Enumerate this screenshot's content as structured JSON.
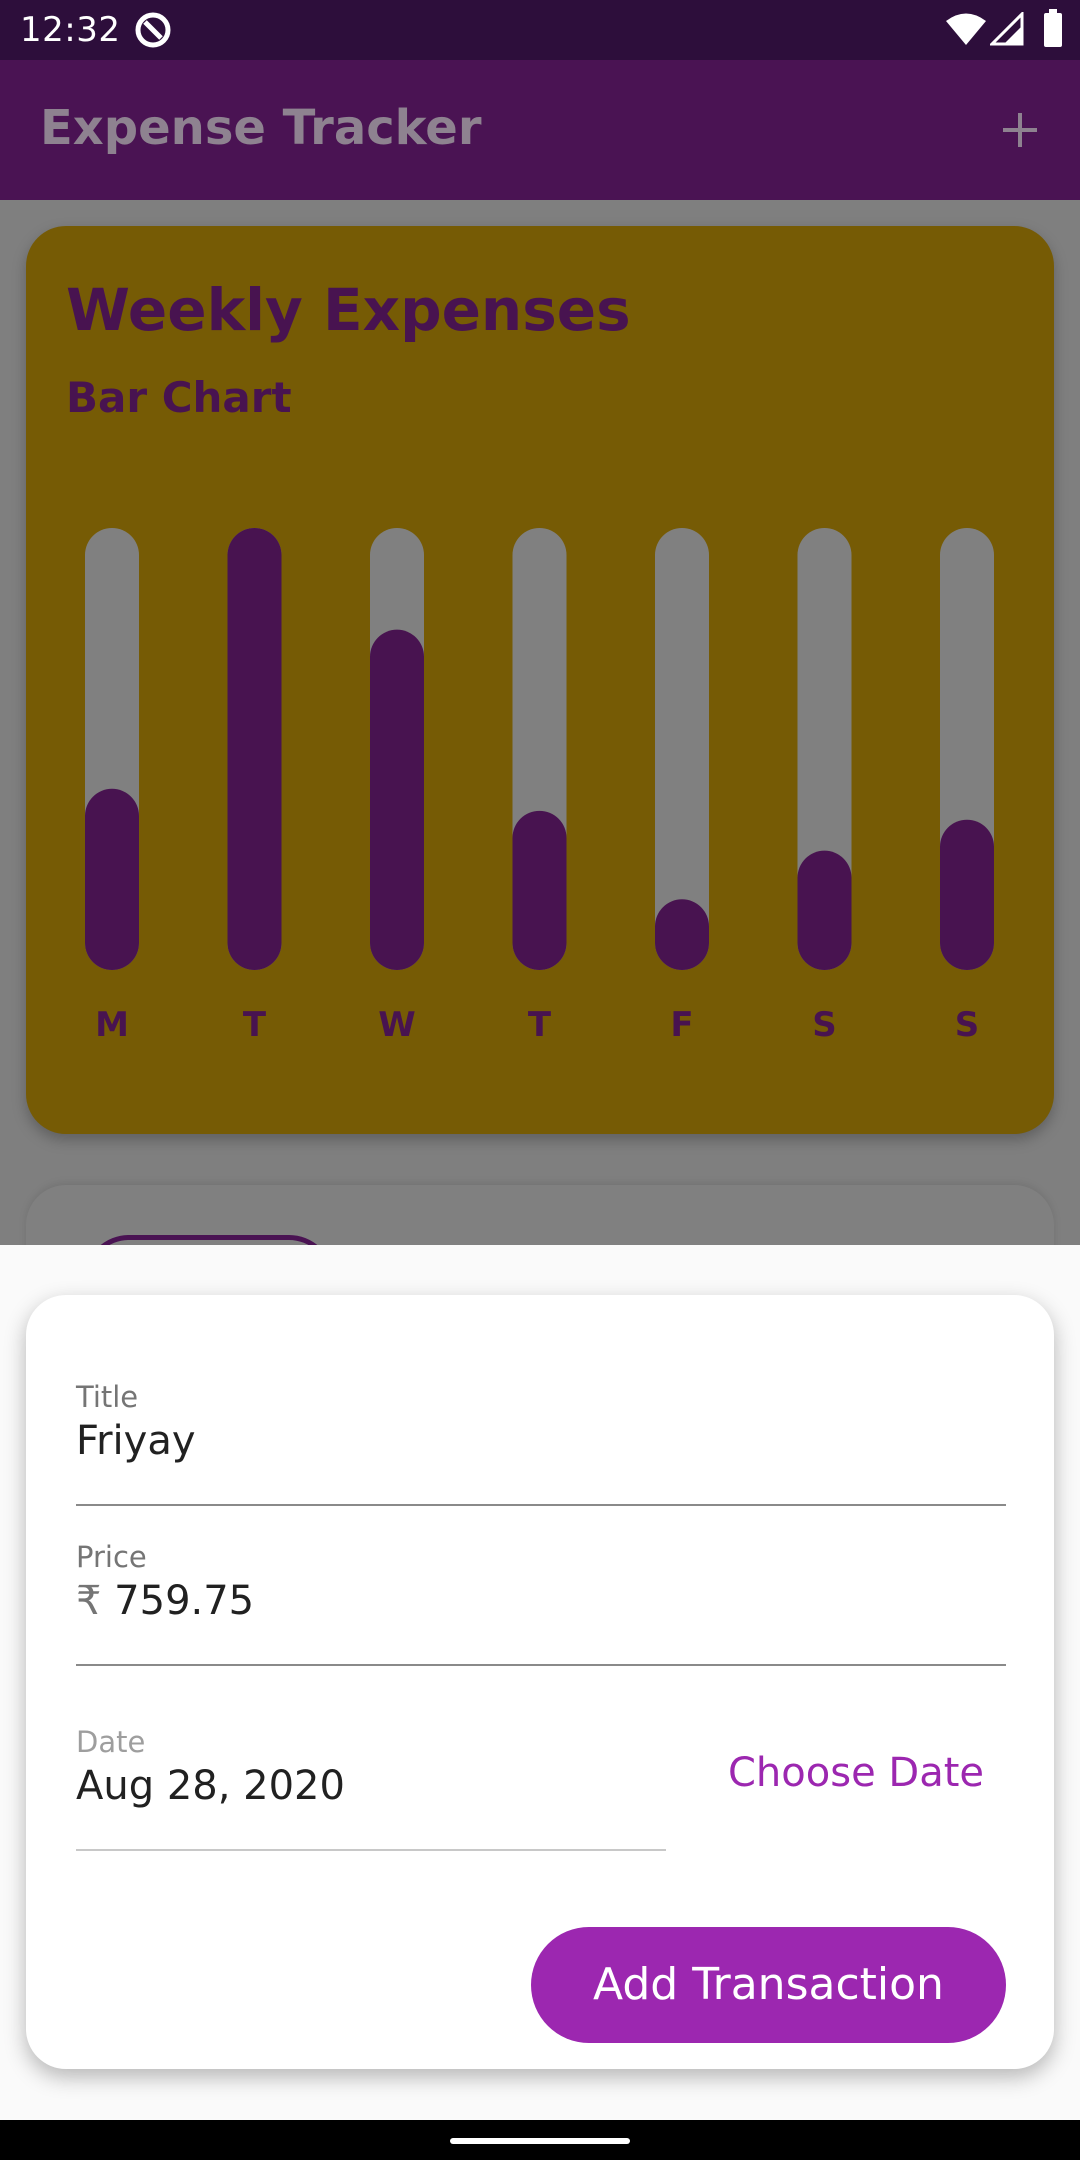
{
  "status_bar": {
    "time": "12:32",
    "app_icon": "no-disturb-icon",
    "wifi_icon": "wifi-icon",
    "signal_icon": "cell-signal-icon",
    "battery_icon": "battery-icon"
  },
  "app_bar": {
    "title": "Expense Tracker",
    "add_icon": "plus-icon"
  },
  "chart": {
    "title": "Weekly Expenses",
    "subtitle": "Bar Chart",
    "background_color": "#765b05",
    "bar_color": "#481350",
    "track_color": "#808080"
  },
  "chart_data": {
    "type": "bar",
    "categories": [
      "M",
      "T",
      "W",
      "T",
      "F",
      "S",
      "S"
    ],
    "values": [
      0.41,
      1.0,
      0.77,
      0.36,
      0.16,
      0.27,
      0.34
    ],
    "ylim": [
      0,
      1
    ]
  },
  "form": {
    "title_label": "Title",
    "title_value": "Friyay",
    "price_label": "Price",
    "currency_symbol": "₹",
    "price_value": "759.75",
    "date_label": "Date",
    "date_value": "Aug 28, 2020",
    "choose_date_label": "Choose Date",
    "add_button_label": "Add Transaction",
    "accent_color": "#9c27b0"
  }
}
